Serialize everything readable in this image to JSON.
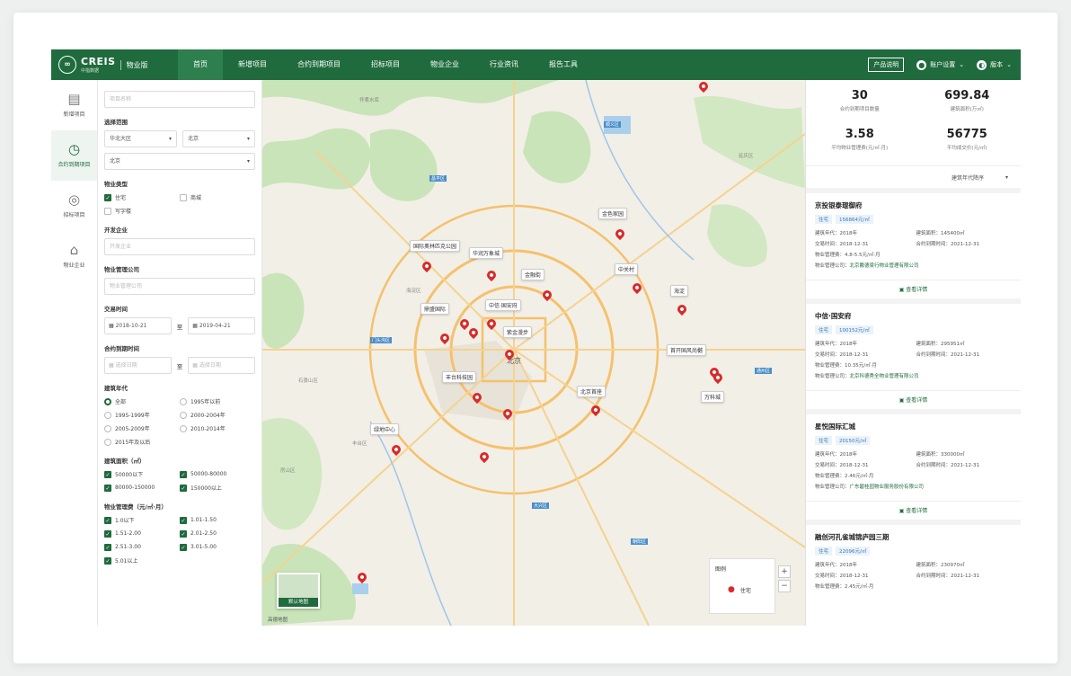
{
  "app": {
    "logo_text": "CREIS",
    "logo_sub": "中指数据",
    "edition": "物业版"
  },
  "nav": {
    "items": [
      "首页",
      "新增项目",
      "合约到期项目",
      "招标项目",
      "物业企业",
      "行业资讯",
      "报告工具"
    ],
    "active_index": 0
  },
  "top_right": {
    "product_btn": "产品说明",
    "account": "账户设置",
    "version": "版本"
  },
  "sidebar": {
    "items": [
      {
        "label": "新增项目",
        "icon": "document-icon"
      },
      {
        "label": "合约到期项目",
        "icon": "clock-icon",
        "active": true
      },
      {
        "label": "招标项目",
        "icon": "bid-icon"
      },
      {
        "label": "物业企业",
        "icon": "company-icon"
      }
    ]
  },
  "filters": {
    "project_name_placeholder": "项目名称",
    "region_label": "选择范围",
    "region_1": "华北大区",
    "region_2": "北京",
    "region_3": "北京",
    "type_label": "物业类型",
    "types": [
      {
        "label": "住宅",
        "checked": true
      },
      {
        "label": "商城",
        "checked": false
      },
      {
        "label": "写字楼",
        "checked": false
      }
    ],
    "developer_label": "开发企业",
    "developer_placeholder": "开发企业",
    "pm_label": "物业管理公司",
    "pm_placeholder": "物业管理公司",
    "trade_label": "交易时间",
    "trade_from": "2018-10-21",
    "trade_sep": "至",
    "trade_to": "2019-04-21",
    "expire_label": "合约到期时间",
    "expire_from_placeholder": "选择日期",
    "expire_to_placeholder": "选择日期",
    "era_label": "建筑年代",
    "eras": [
      {
        "label": "全部",
        "on": true
      },
      {
        "label": "1995年以前",
        "on": false
      },
      {
        "label": "1995-1999年",
        "on": false
      },
      {
        "label": "2000-2004年",
        "on": false
      },
      {
        "label": "2005-2009年",
        "on": false
      },
      {
        "label": "2010-2014年",
        "on": false
      },
      {
        "label": "2015年及以后",
        "on": false
      }
    ],
    "area_label": "建筑面积（㎡）",
    "areas": [
      {
        "label": "50000以下",
        "checked": true
      },
      {
        "label": "50000-80000",
        "checked": true
      },
      {
        "label": "80000-150000",
        "checked": true
      },
      {
        "label": "150000以上",
        "checked": true
      }
    ],
    "fee_label": "物业管理费（元/㎡·月）",
    "fees": [
      {
        "label": "1.0以下",
        "checked": true
      },
      {
        "label": "1.01-1.50",
        "checked": true
      },
      {
        "label": "1.51-2.00",
        "checked": true
      },
      {
        "label": "2.01-2.50",
        "checked": true
      },
      {
        "label": "2.51-3.00",
        "checked": true
      },
      {
        "label": "3.01-5.00",
        "checked": true
      },
      {
        "label": "5.01以上",
        "checked": true
      }
    ]
  },
  "map": {
    "place_labels": [
      "怀柔水库",
      "昌平区",
      "北京",
      "门头沟区",
      "大兴区",
      "顺义区",
      "通州区",
      "延庆区",
      "房山区",
      "朝阳区",
      "海淀区",
      "石景山区",
      "丰台区"
    ],
    "pins": [
      "金色家园",
      "国际奥林匹克公园",
      "华润万象城",
      "金融街",
      "中关村",
      "海淀",
      "鼎盛国际",
      "中信·国安府",
      "紫金漫步",
      "首开国风尚樾",
      "丰台科技园",
      "万科城",
      "北京首座",
      "绿地中心"
    ],
    "legend_title": "图例",
    "legend_item": "住宅",
    "thumb_label": "默认地图",
    "credit": "高德地图",
    "zoom_in": "+",
    "zoom_out": "−"
  },
  "stats": [
    {
      "value": "30",
      "label": "合约到期项目数量"
    },
    {
      "value": "699.84",
      "label": "建筑面积(万㎡)"
    },
    {
      "value": "3.58",
      "label": "平均物业管理费(元/㎡·月)"
    },
    {
      "value": "56775",
      "label": "平均成交价(元/㎡)"
    }
  ],
  "sort_label": "建筑年代降序",
  "cards": [
    {
      "title": "京投银泰琨御府",
      "tags": [
        "住宅",
        "156864元/㎡"
      ],
      "year_k": "建筑年代：",
      "year": "2018年",
      "area_k": "建筑面积：",
      "area": "145400㎡",
      "trade_k": "交易时间：",
      "trade": "2018-12-31",
      "expire_k": "合约到期时间：",
      "expire": "2021-12-31",
      "fee_k": "物业管理费：",
      "fee": "4.8-5.5元/㎡·月",
      "mgmt_k": "物业管理公司：",
      "mgmt": "北京戴德梁行物业管理有限公司",
      "btn": "查看详情"
    },
    {
      "title": "中信·国安府",
      "tags": [
        "住宅",
        "100152元/㎡"
      ],
      "year_k": "建筑年代：",
      "year": "2018年",
      "area_k": "建筑面积：",
      "area": "295951㎡",
      "trade_k": "交易时间：",
      "trade": "2018-12-31",
      "expire_k": "合约到期时间：",
      "expire": "2021-12-31",
      "fee_k": "物业管理费：",
      "fee": "10.35元/㎡·月",
      "mgmt_k": "物业管理公司：",
      "mgmt": "北京科德秀全物业管理有限公司",
      "btn": "查看详情"
    },
    {
      "title": "星悦国际汇城",
      "tags": [
        "住宅",
        "20150元/㎡"
      ],
      "year_k": "建筑年代：",
      "year": "2018年",
      "area_k": "建筑面积：",
      "area": "330000㎡",
      "trade_k": "交易时间：",
      "trade": "2018-12-31",
      "expire_k": "合约到期时间：",
      "expire": "2021-12-31",
      "fee_k": "物业管理费：",
      "fee": "2.46元/㎡·月",
      "mgmt_k": "物业管理公司：",
      "mgmt": "广东碧桂园物业服务股份有限公司",
      "btn": "查看详情"
    },
    {
      "title": "融创河孔雀城锦庐园三期",
      "tags": [
        "住宅",
        "22096元/㎡"
      ],
      "year_k": "建筑年代：",
      "year": "2018年",
      "area_k": "建筑面积：",
      "area": "230970㎡",
      "trade_k": "交易时间：",
      "trade": "2018-12-31",
      "expire_k": "合约到期时间：",
      "expire": "2021-12-31",
      "fee_k": "物业管理费：",
      "fee": "2.45元/㎡·月",
      "mgmt_k": "",
      "mgmt": "",
      "btn": ""
    }
  ],
  "colors": {
    "brand": "#1f6b3d",
    "pin": "#d72b2b",
    "link": "#3a78b5"
  }
}
